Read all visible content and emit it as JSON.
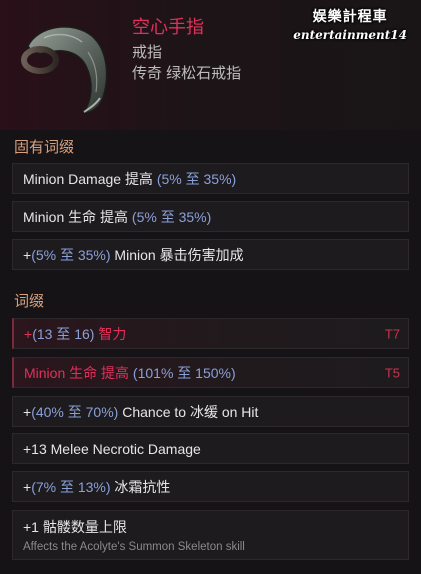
{
  "item": {
    "name": "空心手指",
    "type": "戒指",
    "rarity_line": "传奇 绿松石戒指"
  },
  "watermark": {
    "line1": "娱樂計程車",
    "line2": "entertainment14"
  },
  "implicits": {
    "title": "固有词缀",
    "rows": [
      {
        "pre": "",
        "label": "Minion Damage 提高 ",
        "range": "(5% 至 35%)",
        "post": ""
      },
      {
        "pre": "",
        "label": "Minion 生命 提高 ",
        "range": "(5% 至 35%)",
        "post": ""
      },
      {
        "pre": "+",
        "label": "",
        "range": "(5% 至 35%)",
        "post": " Minion 暴击伤害加成"
      }
    ]
  },
  "affixes": {
    "title": "词缀",
    "rows": [
      {
        "pre": "+",
        "range": "(13 至 16)",
        "label": " 智力",
        "tier": "T7"
      },
      {
        "label": "Minion 生命 提高 ",
        "range": "(101% 至 150%)",
        "tier": "T5"
      },
      {
        "pre": "+",
        "range": "(40% 至 70%)",
        "label": " Chance to 冰缓 on Hit"
      },
      {
        "label": "+13 Melee Necrotic Damage"
      },
      {
        "pre": "+",
        "range": "(7% 至 13%)",
        "label": " 冰霜抗性"
      },
      {
        "label": "+1 骷髅数量上限",
        "desc": "Affects the Acolyte's Summon Skeleton skill"
      }
    ]
  },
  "colors": {
    "legendary_name": "#e0305c",
    "range_blue": "#8aa0d8",
    "section_header": "#d9a07e",
    "tier_red": "#c8354e"
  },
  "icons": [
    "hollow-finger-ring-icon"
  ]
}
